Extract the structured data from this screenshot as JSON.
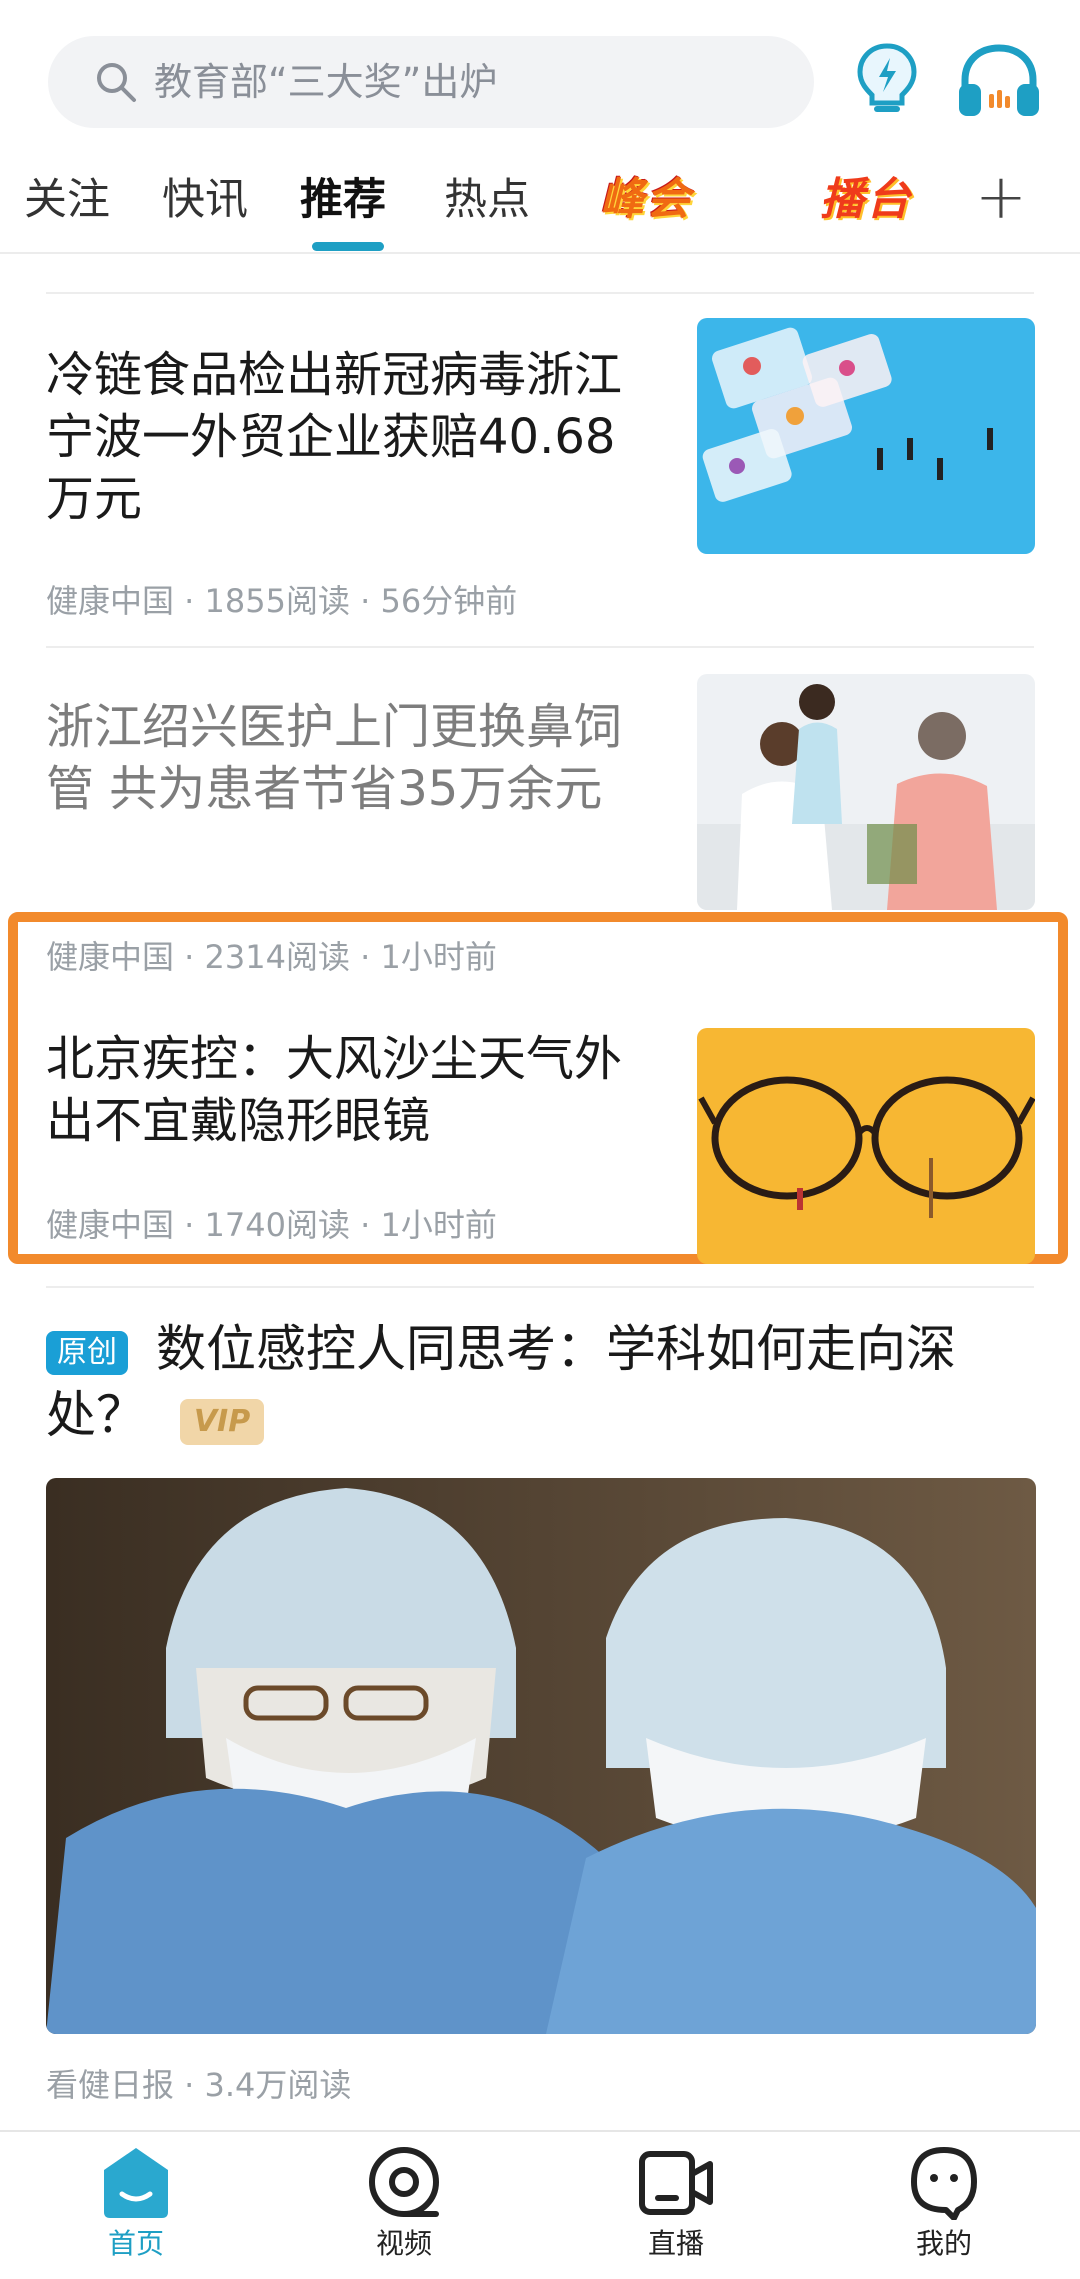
{
  "search": {
    "placeholder": "教育部“三大奖”出炉"
  },
  "tabs": [
    {
      "label": "关注",
      "active": false
    },
    {
      "label": "快讯",
      "active": false
    },
    {
      "label": "推荐",
      "active": true
    },
    {
      "label": "热点",
      "active": false
    }
  ],
  "tab_logos": {
    "peak": "峰会",
    "stage": "播台"
  },
  "tab_add": "+",
  "feed": {
    "articles": [
      {
        "title": "冷链食品检出新冠病毒浙江宁波一外贸企业获赔40.68万元",
        "meta": "健康中国 · 1855阅读 · 56分钟前"
      },
      {
        "title": "浙江绍兴医护上门更换鼻饲管 共为患者节省35万余元",
        "meta": "健康中国 · 2314阅读 · 1小时前"
      },
      {
        "title": "北京疾控：大风沙尘天气外出不宜戴隐形眼镜",
        "meta": "健康中国 · 1740阅读 · 1小时前"
      }
    ],
    "featured": {
      "tag": "原创",
      "title": "数位感控人同思考：学科如何走向深处？",
      "vip": "VIP",
      "meta": "看健日报 · 3.4万阅读"
    }
  },
  "bottom_nav": [
    {
      "label": "首页",
      "icon": "home-icon",
      "active": true
    },
    {
      "label": "视频",
      "icon": "video-icon",
      "active": false
    },
    {
      "label": "直播",
      "icon": "live-camera-icon",
      "active": false
    },
    {
      "label": "我的",
      "icon": "profile-icon",
      "active": false
    }
  ],
  "colors": {
    "accent": "#1e9fc4",
    "highlight_border": "#f28a2c"
  }
}
